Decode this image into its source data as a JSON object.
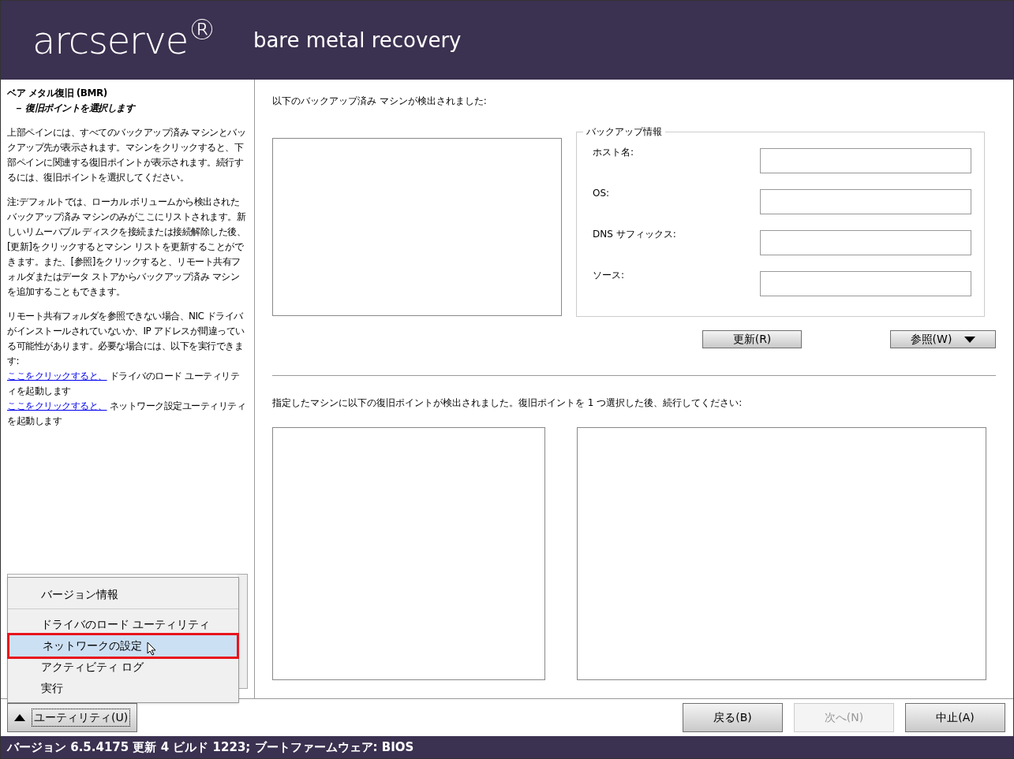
{
  "header": {
    "logo": "arcserve$^{®}$",
    "title": "bare metal recovery"
  },
  "sidebar": {
    "title": "ベア メタル復旧 (BMR)",
    "subtitle": "－ 復旧ポイントを選択します",
    "paragraphs": [
      "上部ペインには、すべてのバックアップ済み マシンとバックアップ先が表示されます。マシンをクリックすると、下部ペインに関連する復旧ポイントが表示されます。続行するには、復旧ポイントを選択してください。",
      "注:デフォルトでは、ローカル ボリュームから検出されたバックアップ済み マシンのみがここにリストされます。新しいリムーバブル ディスクを接続または接続解除した後、[更新]をクリックするとマシン リストを更新することができます。また、[参照]をクリックすると、リモート共有フォルダまたはデータ ストアからバックアップ済み マシンを追加することもできます。"
    ],
    "help": {
      "intro": "リモート共有フォルダを参照できない場合、NIC ドライバがインストールされていないか、IP アドレスが間違っている可能性があります。必要な場合には、以下を実行できます:",
      "links": [
        {
          "link": "ここをクリックすると、",
          "text": "ドライバのロード ユーティリティを起動します"
        },
        {
          "link": "ここをクリックすると、",
          "text": "ネットワーク設定ユーティリティを起動します"
        }
      ]
    },
    "utility_button": "ユーティリティ(U)"
  },
  "menu": {
    "items": [
      {
        "label": "バージョン情報",
        "selected": false,
        "separator_after": true
      },
      {
        "label": "ドライバのロード ユーティリティ",
        "selected": false,
        "separator_after": false
      },
      {
        "label": "ネットワークの設定",
        "selected": true,
        "separator_after": false
      },
      {
        "label": "アクティビティ ログ",
        "selected": false,
        "separator_after": false
      },
      {
        "label": "実行",
        "selected": false,
        "separator_after": false
      }
    ]
  },
  "main": {
    "machines_label": "以下のバックアップ済み マシンが検出されました:",
    "backup_info": {
      "legend": "バックアップ情報",
      "fields": [
        {
          "label": "ホスト名:"
        },
        {
          "label": "OS:"
        },
        {
          "label": "DNS サフィックス:"
        },
        {
          "label": "ソース:"
        }
      ]
    },
    "refresh_button": "更新(R)",
    "browse_button": "参照(W)",
    "points_label": "指定したマシンに以下の復旧ポイントが検出されました。復旧ポイントを 1 つ選択した後、続行してください:"
  },
  "footer": {
    "buttons": [
      {
        "label": "戻る(B)",
        "disabled": false
      },
      {
        "label": "次へ(N)",
        "disabled": true
      },
      {
        "label": "中止(A)",
        "disabled": false
      }
    ]
  },
  "status_bar": "バージョン 6.5.4175 更新 4 ビルド 1223; ブートファームウェア: BIOS"
}
